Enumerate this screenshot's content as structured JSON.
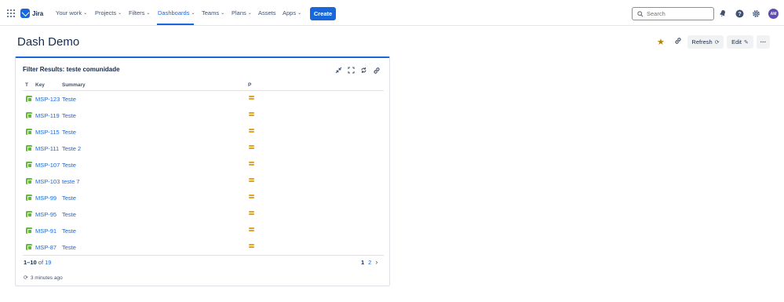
{
  "nav": {
    "product": "Jira",
    "items": [
      {
        "label": "Your work"
      },
      {
        "label": "Projects"
      },
      {
        "label": "Filters"
      },
      {
        "label": "Dashboards"
      },
      {
        "label": "Teams"
      },
      {
        "label": "Plans"
      },
      {
        "label": "Assets"
      },
      {
        "label": "Apps"
      }
    ],
    "create_label": "Create",
    "search_placeholder": "Search",
    "avatar_initials": "AM",
    "accent_color": "#1868db"
  },
  "page": {
    "title": "Dash Demo",
    "refresh_label": "Refresh",
    "edit_label": "Edit",
    "more_label": "···"
  },
  "gadget": {
    "title": "Filter Results: teste comunidade",
    "columns": {
      "type": "T",
      "key": "Key",
      "summary": "Summary",
      "priority": "P"
    },
    "rows": [
      {
        "key": "MSP-123",
        "summary": "Teste",
        "priority": "Medium"
      },
      {
        "key": "MSP-119",
        "summary": "Teste",
        "priority": "Medium"
      },
      {
        "key": "MSP-115",
        "summary": "Teste",
        "priority": "Medium"
      },
      {
        "key": "MSP-111",
        "summary": "Teste 2",
        "priority": "Medium"
      },
      {
        "key": "MSP-107",
        "summary": "Teste",
        "priority": "Medium"
      },
      {
        "key": "MSP-103",
        "summary": "teste 7",
        "priority": "Medium"
      },
      {
        "key": "MSP-99",
        "summary": "Teste",
        "priority": "Medium"
      },
      {
        "key": "MSP-95",
        "summary": "Teste",
        "priority": "Medium"
      },
      {
        "key": "MSP-91",
        "summary": "Teste",
        "priority": "Medium"
      },
      {
        "key": "MSP-87",
        "summary": "Teste",
        "priority": "Medium"
      }
    ],
    "range": "1–10",
    "of": "of",
    "total": "19",
    "pages": {
      "current": "1",
      "next": "2"
    },
    "updated": "3 minutes ago"
  }
}
